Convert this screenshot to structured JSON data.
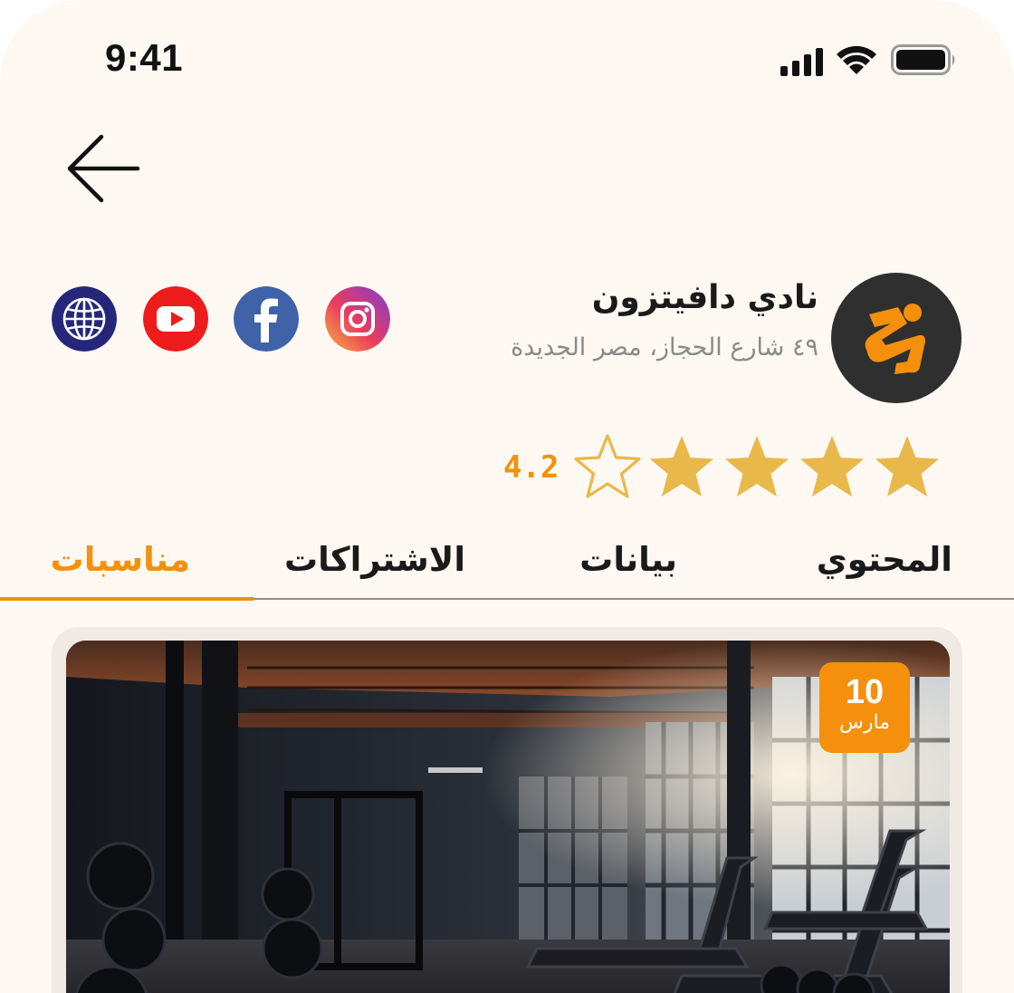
{
  "status_bar": {
    "time": "9:41"
  },
  "club": {
    "name": "نادي دافيتزون",
    "address": "٤٩ شارع الحجاز، مصر الجديدة",
    "logo_colors": {
      "background": "#2f2f2f",
      "mark": "#f4900c"
    }
  },
  "social_links": [
    {
      "name": "instagram",
      "icon": "instagram-icon"
    },
    {
      "name": "facebook",
      "icon": "facebook-icon"
    },
    {
      "name": "youtube",
      "icon": "youtube-icon"
    },
    {
      "name": "website",
      "icon": "globe-icon"
    }
  ],
  "rating": {
    "value": "4.2",
    "filled_stars": 4,
    "total_stars": 5
  },
  "tabs": [
    {
      "label": "المحتوي",
      "active": false
    },
    {
      "label": "بيانات",
      "active": false
    },
    {
      "label": "الاشتراكات",
      "active": false
    },
    {
      "label": "مناسبات",
      "active": true
    }
  ],
  "event": {
    "date_day": "10",
    "date_month": "مارس",
    "image": "gym-interior-photo"
  },
  "colors": {
    "accent": "#f4900c",
    "star": "#e8b84a",
    "background": "#fdf8f2",
    "text": "#1a1a1a",
    "muted": "#8a8a8a"
  }
}
